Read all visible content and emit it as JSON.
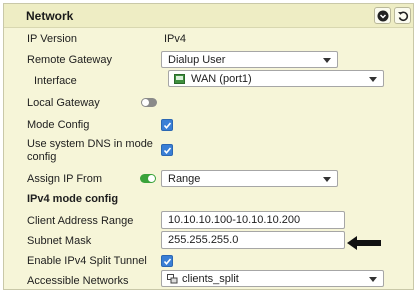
{
  "header": {
    "title": "Network",
    "collapse_icon": "chevron-circle-icon",
    "reset_icon": "undo-icon"
  },
  "rows": {
    "ip_version": {
      "label": "IP Version",
      "value": "IPv4"
    },
    "remote_gateway": {
      "label": "Remote Gateway",
      "value": "Dialup User"
    },
    "interface": {
      "label": "Interface",
      "value": "WAN (port1)"
    },
    "local_gateway": {
      "label": "Local Gateway",
      "enabled": false
    },
    "mode_config": {
      "label": "Mode Config",
      "checked": true
    },
    "system_dns": {
      "label": "Use system DNS in mode config",
      "checked": true
    },
    "assign_ip_from": {
      "label": "Assign IP From",
      "enabled": true,
      "value": "Range"
    },
    "section_title": "IPv4 mode config",
    "client_range": {
      "label": "Client Address Range",
      "value": "10.10.10.100-10.10.10.200"
    },
    "subnet_mask": {
      "label": "Subnet Mask",
      "value": "255.255.255.0"
    },
    "split_tunnel": {
      "label": "Enable IPv4 Split Tunnel",
      "checked": true
    },
    "accessible_networks": {
      "label": "Accessible Networks",
      "value": "clients_split"
    }
  },
  "colors": {
    "panel_bg": "#f6f5d8",
    "header_bg": "#eeedc4",
    "checkbox": "#3a7fd6",
    "toggle_on": "#3aa33a",
    "toggle_off": "#8a8a8a"
  }
}
